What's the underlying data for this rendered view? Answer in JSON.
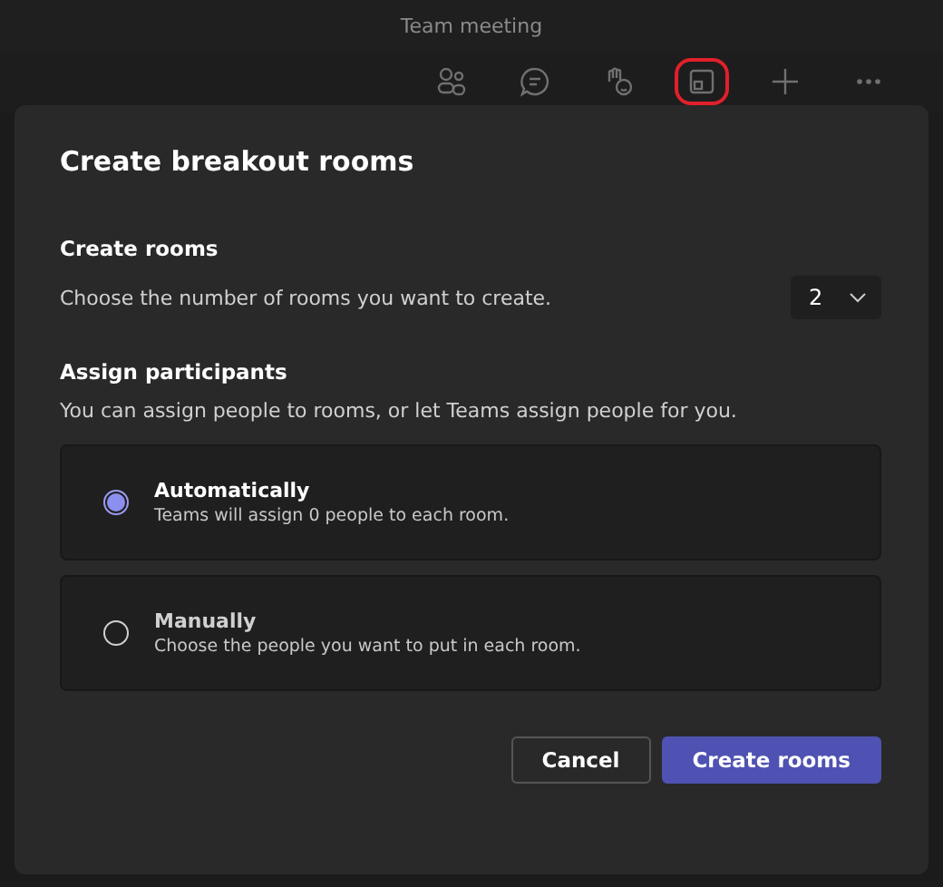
{
  "window": {
    "title": "Team meeting"
  },
  "toolbar": [
    {
      "kind": "people",
      "highlighted": false
    },
    {
      "kind": "chat",
      "highlighted": false
    },
    {
      "kind": "reactions",
      "highlighted": false
    },
    {
      "kind": "rooms",
      "highlighted": true
    },
    {
      "kind": "add",
      "highlighted": false
    },
    {
      "kind": "more",
      "highlighted": false
    }
  ],
  "dialog": {
    "title": "Create breakout rooms",
    "create_rooms": {
      "heading": "Create rooms",
      "description": "Choose the number of rooms you want to create.",
      "count": "2"
    },
    "assign": {
      "heading": "Assign participants",
      "description": "You can assign people to rooms, or let Teams assign people for you.",
      "options": [
        {
          "label": "Automatically",
          "description": "Teams will assign 0 people to each room.",
          "selected": true
        },
        {
          "label": "Manually",
          "description": "Choose the people you want to put in each room.",
          "selected": false
        }
      ]
    },
    "buttons": [
      {
        "label": "Cancel",
        "kind": "secondary"
      },
      {
        "label": "Create rooms",
        "kind": "primary"
      }
    ]
  }
}
